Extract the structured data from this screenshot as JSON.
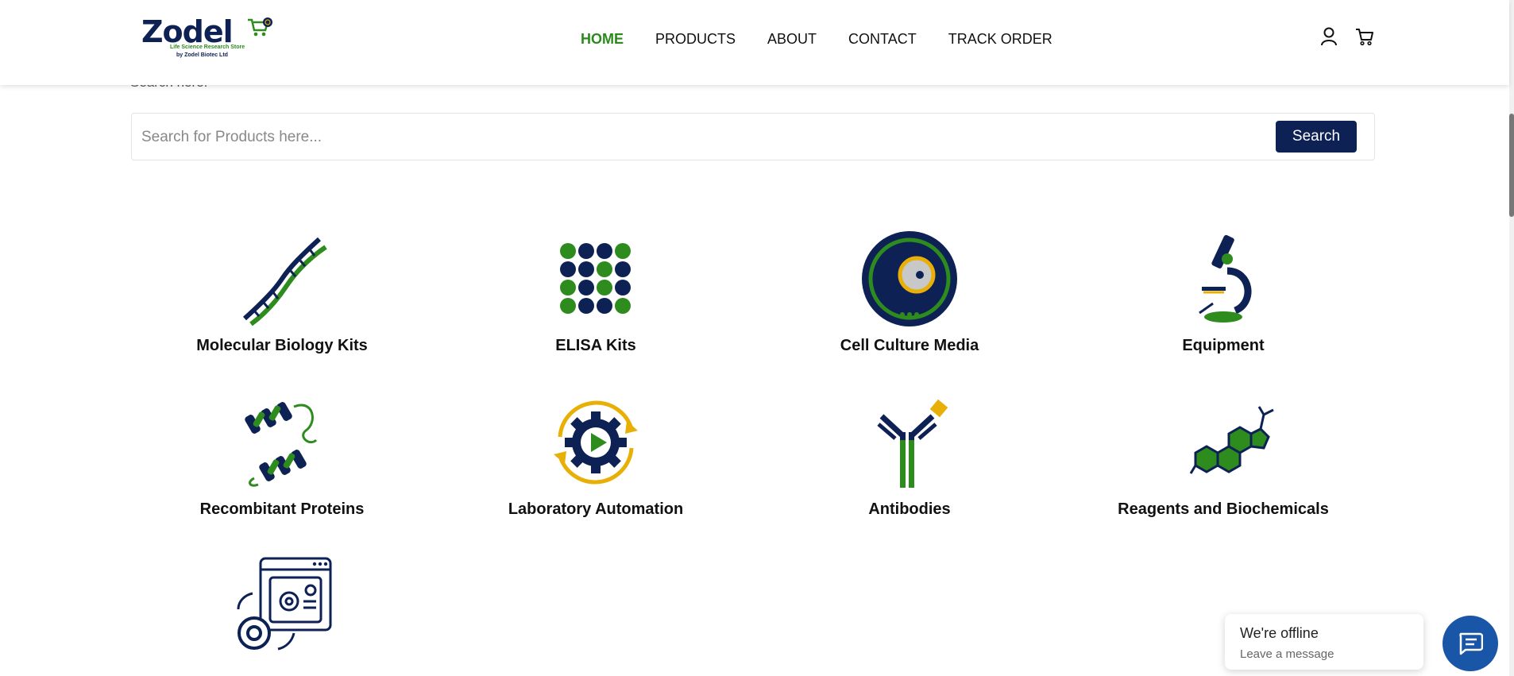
{
  "header": {
    "logo": {
      "brand": "Zodel",
      "tagline": "Life Science Research Store",
      "by": "by Zodel Biotec Ltd"
    },
    "nav": [
      "HOME",
      "PRODUCTS",
      "ABOUT",
      "CONTACT",
      "TRACK ORDER"
    ],
    "active_nav": "HOME",
    "icons": [
      "user-icon",
      "cart-icon"
    ]
  },
  "search": {
    "hint": "Search here:",
    "placeholder": "Search for Products here...",
    "button": "Search"
  },
  "categories": [
    {
      "label": "Molecular Biology Kits",
      "icon": "dna-icon"
    },
    {
      "label": "ELISA Kits",
      "icon": "elisa-plate-icon"
    },
    {
      "label": "Cell Culture Media",
      "icon": "petri-dish-icon"
    },
    {
      "label": "Equipment",
      "icon": "microscope-icon"
    },
    {
      "label": "Recombitant Proteins",
      "icon": "protein-helix-icon"
    },
    {
      "label": "Laboratory Automation",
      "icon": "automation-gear-icon"
    },
    {
      "label": "Antibodies",
      "icon": "antibody-icon"
    },
    {
      "label": "Reagents and Biochemicals",
      "icon": "molecule-icon"
    },
    {
      "label": "",
      "icon": "software-settings-icon"
    }
  ],
  "chat": {
    "status": "We're offline",
    "action": "Leave a message",
    "icon": "chat-icon"
  },
  "colors": {
    "navy": "#0e2155",
    "green": "#2a8a1a",
    "gold": "#e8b007",
    "chat_blue": "#1a56a8"
  }
}
